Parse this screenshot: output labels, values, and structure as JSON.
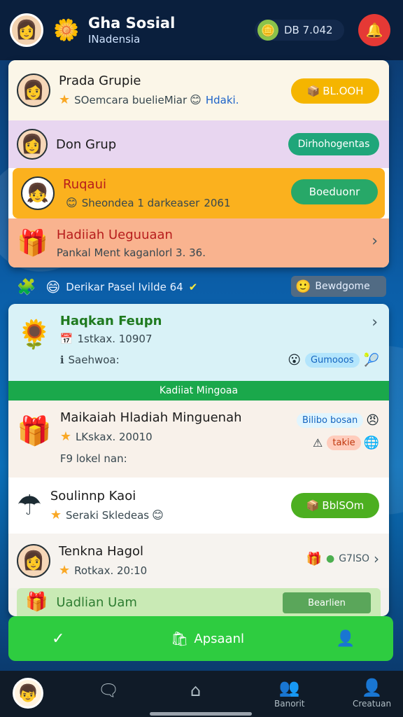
{
  "header": {
    "app_title": "Gha Sosial",
    "app_subtitle": "INadensia",
    "coin_text": "DB  7.042"
  },
  "groups": [
    {
      "title": "Prada Grupie",
      "sub": "SOemcara buelieMiar",
      "sub_tag": "Hdaki.",
      "button": "BL.OOH"
    },
    {
      "title": "Don Grup",
      "button": "Dirhohogentas"
    },
    {
      "title": "Ruqaui",
      "sub": "Sheondea 1 darkeaser",
      "sub_tag": "2061",
      "button": "Boeduonr"
    },
    {
      "title": "Hadiiah Ueguuaan",
      "sub": "Pankal Ment kaganlorl 3. 36."
    }
  ],
  "promo": {
    "text": "Derikar Pasel Ivilde 64",
    "button": "Bewdgome"
  },
  "daily": {
    "title": "Haqkan Feupn",
    "sub": "1stkax. 10907",
    "sub2": "Saehwoa:",
    "tag": "Gumooos",
    "banner": "Kadiiat Mingoaa"
  },
  "items": [
    {
      "title": "Maikaiah Hladiah Minguenah",
      "sub": "LKskax. 20010",
      "sub2": "F9 lokel nan:",
      "tag1": "Bilibo bosan",
      "tag2": "takie"
    },
    {
      "title": "Soulinnp Kaoi",
      "sub": "Seraki Skledeas",
      "button": "BblSOm"
    },
    {
      "title": "Tenkna Hagol",
      "sub": "Rotkax. 20:10",
      "code": "G7ISO"
    },
    {
      "title": "Uadlian Uam",
      "button": "Bearlien"
    }
  ],
  "action_bar": {
    "label": "Apsaanl"
  },
  "nav": {
    "item4": "Banorit",
    "item5": "Creatuan"
  }
}
